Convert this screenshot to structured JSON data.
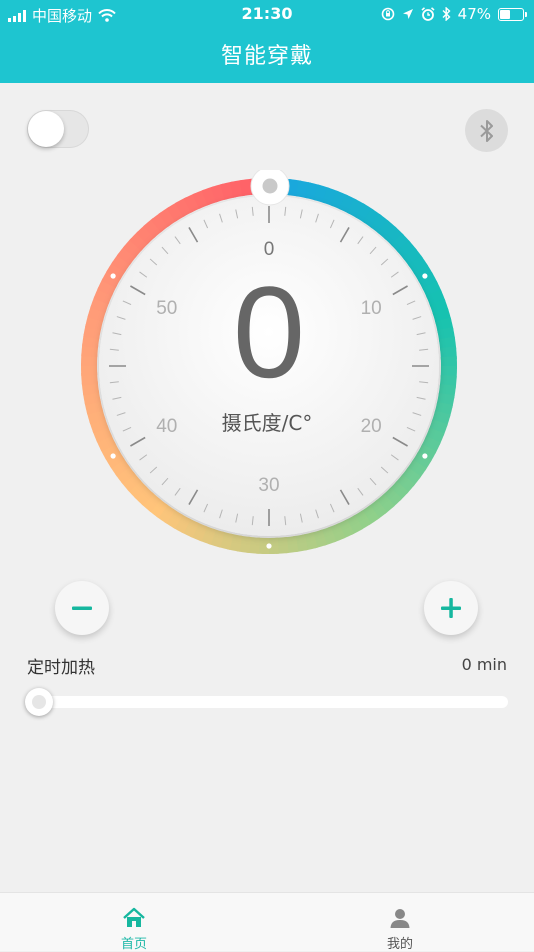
{
  "status_bar": {
    "carrier": "中国移动",
    "time": "21:30",
    "battery": "47%",
    "battery_level": 0.47
  },
  "header": {
    "title": "智能穿戴"
  },
  "power_toggle": {
    "on": false
  },
  "bluetooth": {
    "icon": "bluetooth-icon"
  },
  "dial": {
    "value": "0",
    "unit_label": "摄氏度/C°",
    "scale_labels": [
      "0",
      "10",
      "20",
      "30",
      "40",
      "50"
    ],
    "range": [
      0,
      60
    ],
    "gradient_colors": [
      "#1aa6e0",
      "#16c2b0",
      "#8fd08a",
      "#ffc57a",
      "#ff9a78",
      "#ff5b66"
    ]
  },
  "controls": {
    "minus_icon": "minus-icon",
    "plus_icon": "plus-icon",
    "accent": "#16b79f"
  },
  "timer": {
    "label": "定时加热",
    "value": "0 min",
    "level": 0
  },
  "tabs": [
    {
      "label": "首页",
      "icon": "home-icon",
      "active": true
    },
    {
      "label": "我的",
      "icon": "person-icon",
      "active": false
    }
  ]
}
